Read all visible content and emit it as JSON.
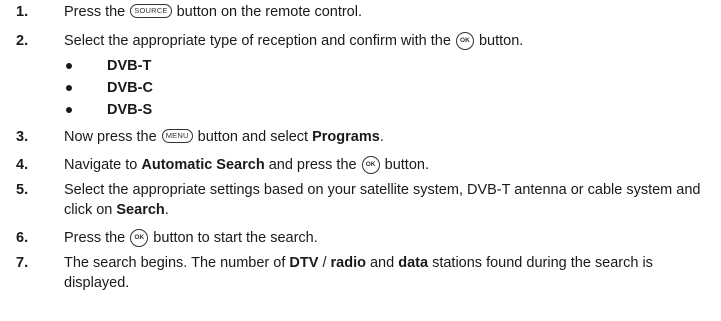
{
  "steps": [
    {
      "num": "1.",
      "pre": "Press the ",
      "button": "SOURCE",
      "post": " button on the remote control."
    },
    {
      "num": "2.",
      "pre": "Select the appropriate type of reception and confirm with the ",
      "button": "OK",
      "post": " button."
    },
    {
      "num": "3.",
      "pre": "Now press the ",
      "button": "MENU",
      "post": " button and select ",
      "bold": "Programs",
      "tail": "."
    },
    {
      "num": "4.",
      "pre": "Navigate to ",
      "bold": "Automatic Search",
      "mid": " and press the ",
      "button": "OK",
      "post": " button."
    },
    {
      "num": "5.",
      "pre": "Select the appropriate settings based on your satellite system, DVB-T antenna or cable system and click on ",
      "bold": "Search",
      "tail": "."
    },
    {
      "num": "6.",
      "pre": "Press the ",
      "button": "OK",
      "post": " button to start the search."
    },
    {
      "num": "7.",
      "pre": "The search begins. The number of ",
      "b1": "DTV",
      "s1": " / ",
      "b2": "radio",
      "s2": " and ",
      "b3": "data",
      "post": " stations found during the search is displayed."
    }
  ],
  "reception_types": [
    "DVB-T",
    "DVB-C",
    "DVB-S"
  ],
  "icons": {
    "bullet": "filled-circle",
    "source_button": "oval-source-button",
    "menu_button": "oval-menu-button",
    "ok_button": "circle-ok-button"
  }
}
